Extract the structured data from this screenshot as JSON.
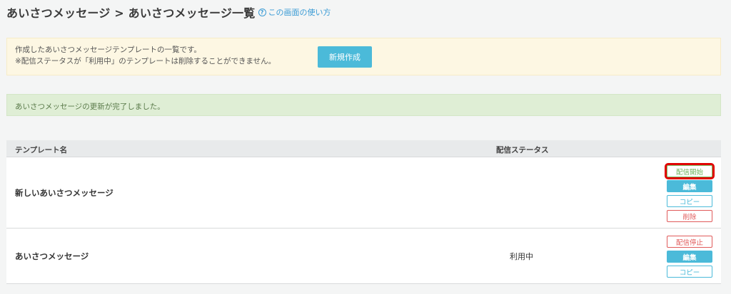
{
  "header": {
    "breadcrumb": "あいさつメッセージ > あいさつメッセージ一覧",
    "help_icon": "question-circle-icon",
    "help_link": "この画面の使い方"
  },
  "notice": {
    "line1": "作成したあいさつメッセージテンプレートの一覧です。",
    "line2": "※配信ステータスが「利用中」のテンプレートは削除することができません。",
    "new_button": "新規作成"
  },
  "success_message": "あいさつメッセージの更新が完了しました。",
  "table": {
    "columns": [
      "テンプレート名",
      "配信ステータス"
    ],
    "rows": [
      {
        "name": "新しいあいさつメッセージ",
        "status": "",
        "actions": [
          "配信開始",
          "編集",
          "コピー",
          "削除"
        ]
      },
      {
        "name": "あいさつメッセージ",
        "status": "利用中",
        "actions": [
          "配信停止",
          "編集",
          "コピー"
        ]
      }
    ]
  },
  "colors": {
    "accent": "#4bbad9",
    "danger": "#e05a5a",
    "success": "#6cb35a",
    "highlight": "#e00000"
  }
}
